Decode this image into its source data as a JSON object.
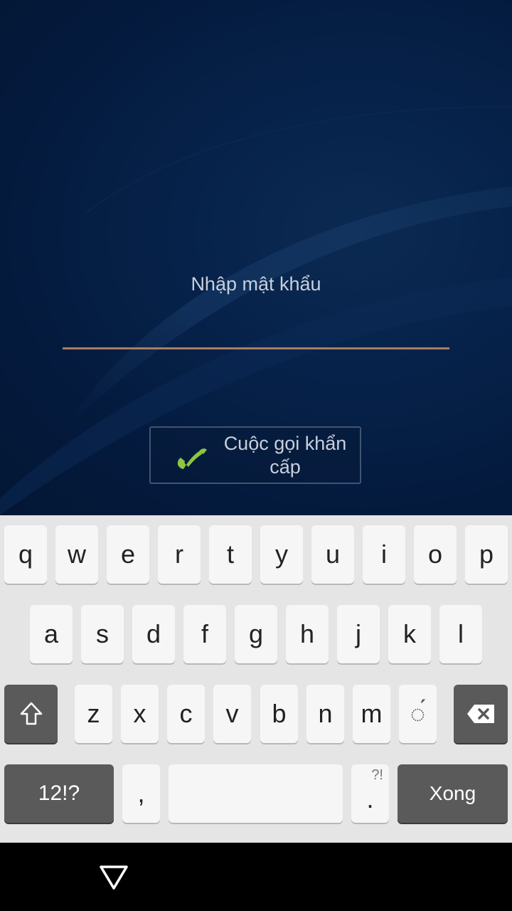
{
  "lockscreen": {
    "prompt": "Nhập mật khẩu",
    "password_value": "",
    "emergency_call_label": "Cuộc gọi khẩn cấp"
  },
  "keyboard": {
    "row1": [
      "q",
      "w",
      "e",
      "r",
      "t",
      "y",
      "u",
      "i",
      "o",
      "p"
    ],
    "row2": [
      "a",
      "s",
      "d",
      "f",
      "g",
      "h",
      "j",
      "k",
      "l"
    ],
    "row3": [
      "z",
      "x",
      "c",
      "v",
      "b",
      "n",
      "m",
      "◌́"
    ],
    "symbols_label": "12!?",
    "comma_label": ",",
    "period_label": ".",
    "period_sub_label": "?!",
    "done_label": "Xong",
    "shift_icon": "shift-icon",
    "backspace_icon": "backspace-icon"
  },
  "navbar": {
    "back_icon": "back-triangle-icon"
  },
  "colors": {
    "background": "#041a3d",
    "underline": "#a97d5f",
    "phone_icon": "#8dc63f",
    "key_dark": "#5a5a5a"
  }
}
